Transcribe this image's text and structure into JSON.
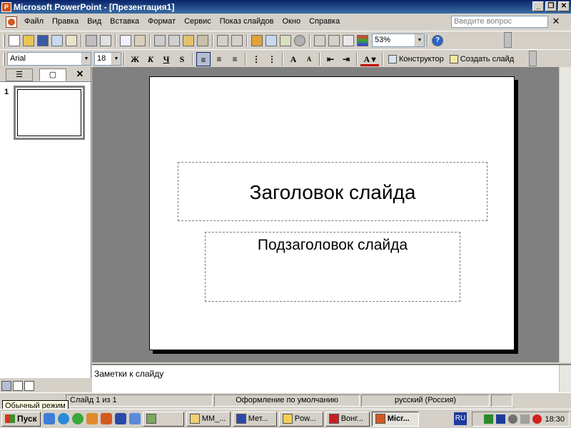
{
  "window": {
    "title": "Microsoft PowerPoint - [Презентация1]",
    "app_icon": "powerpoint-icon",
    "controls": [
      "_",
      "❐",
      "✕"
    ]
  },
  "menubar": {
    "items": [
      "Файл",
      "Правка",
      "Вид",
      "Вставка",
      "Формат",
      "Сервис",
      "Показ слайдов",
      "Окно",
      "Справка"
    ],
    "help_placeholder": "Введите вопрос",
    "close_glyph": "✕"
  },
  "toolbar_standard": {
    "zoom": "53%",
    "help_glyph": "?"
  },
  "toolbar_format": {
    "font": "Arial",
    "size": "18",
    "bold": "Ж",
    "italic": "К",
    "underline": "Ч",
    "shadow": "S",
    "designer": "Конструктор",
    "new_slide": "Создать слайд"
  },
  "pane": {
    "tab_outline_glyph": "☰",
    "tab_slides_glyph": "▢",
    "close_glyph": "✕",
    "slide_number": "1"
  },
  "slide": {
    "title": "Заголовок слайда",
    "subtitle": "Подзаголовок слайда"
  },
  "notes": {
    "placeholder": "Заметки к слайду"
  },
  "view_tooltip": "Обычный режим",
  "statusbar": {
    "slide": "Слайд 1 из 1",
    "design": "Оформление по умолчанию",
    "language": "русский (Россия)"
  },
  "taskbar": {
    "start": "Пуск",
    "tasks": [
      "MM_...",
      "Мет...",
      "Pow...",
      "Вонг...",
      "Micr..."
    ],
    "lang": "RU",
    "clock": "18:30"
  },
  "colors": {
    "titlebar_start": "#0a246a",
    "titlebar_end": "#3a6ea5",
    "workspace": "#808080",
    "chrome": "#d4d0c8"
  }
}
